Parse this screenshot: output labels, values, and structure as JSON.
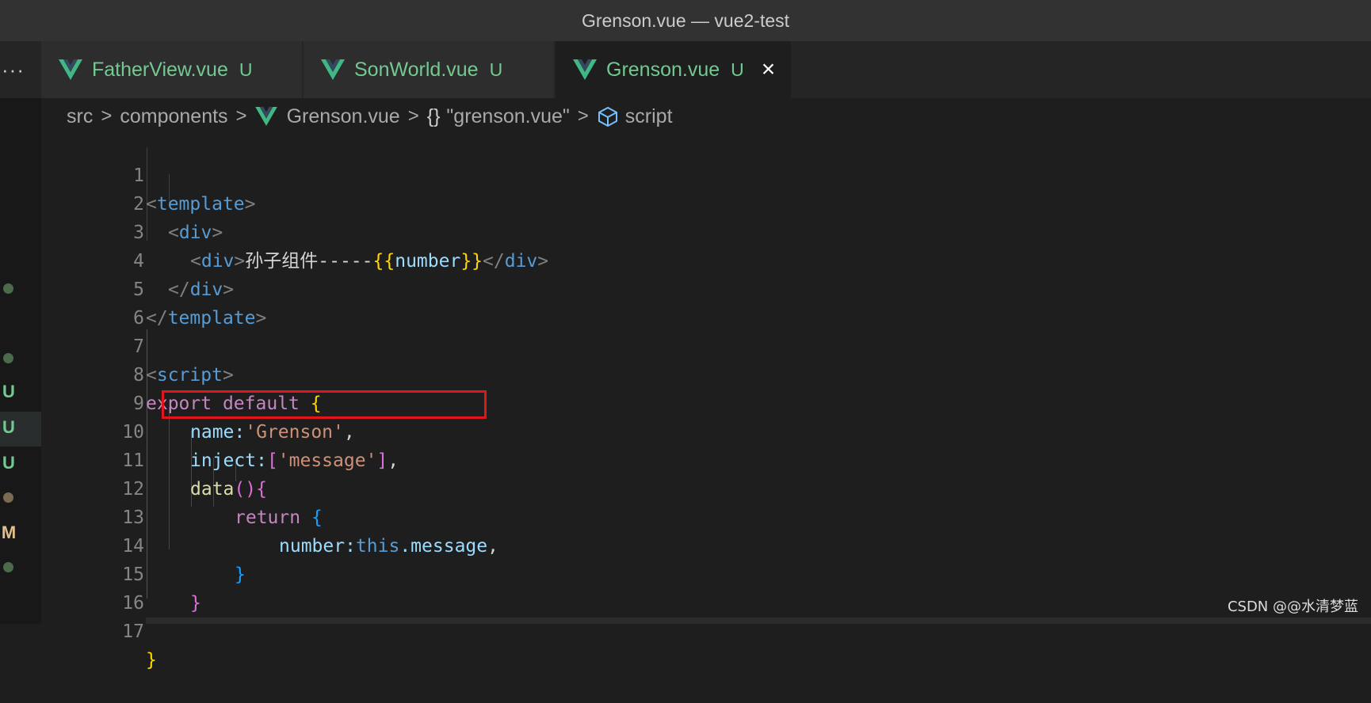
{
  "window": {
    "title": "Grenson.vue — vue2-test"
  },
  "tabs": [
    {
      "label": "FatherView.vue",
      "status": "U"
    },
    {
      "label": "SonWorld.vue",
      "status": "U"
    },
    {
      "label": "Grenson.vue",
      "status": "U",
      "active": true
    }
  ],
  "tabbar": {
    "overflow": "···",
    "close": "×"
  },
  "breadcrumb": {
    "items": [
      "src",
      "components",
      "Grenson.vue",
      "\"grenson.vue\"",
      "script"
    ],
    "separator": ">",
    "brace": "{}"
  },
  "gutter_marks": [
    "U",
    "U",
    "U",
    "M"
  ],
  "colors": {
    "vue": "#41b883",
    "modified": "#73c991",
    "highlight_box": "#e0161b"
  },
  "code": {
    "line_numbers": [
      "1",
      "2",
      "3",
      "4",
      "5",
      "6",
      "7",
      "8",
      "9",
      "10",
      "11",
      "12",
      "13",
      "14",
      "15",
      "16",
      "17"
    ],
    "l1": {
      "open": "<",
      "tag": "template",
      "close": ">"
    },
    "l2": {
      "open": "<",
      "tag": "div",
      "close": ">"
    },
    "l3": {
      "open": "<",
      "tag": "div",
      "close": ">",
      "text": "孙子组件-----",
      "mopen": "{{",
      "var": "number",
      "mclose": "}}",
      "endopen": "</",
      "endtag": "div",
      "endclose": ">"
    },
    "l4": {
      "open": "</",
      "tag": "div",
      "close": ">"
    },
    "l5": {
      "open": "</",
      "tag": "template",
      "close": ">"
    },
    "l7": {
      "open": "<",
      "tag": "script",
      "close": ">"
    },
    "l8": {
      "kw1": "export",
      "kw2": "default",
      "brace": "{"
    },
    "l9": {
      "prop": "name:",
      "str": "'Grenson'",
      "punc": ","
    },
    "l10": {
      "prop": "inject:",
      "bopen": "[",
      "str": "'message'",
      "bclose": "]",
      "punc": ","
    },
    "l11": {
      "fn": "data",
      "parens": "()",
      "brace": "{"
    },
    "l12": {
      "kw": "return",
      "brace": "{"
    },
    "l13": {
      "prop": "number:",
      "this": "this",
      "rest": ".message",
      "punc": ","
    },
    "l14": {
      "brace": "}"
    },
    "l15": {
      "brace": "}"
    },
    "l17": {
      "brace": "}"
    }
  },
  "watermark": "CSDN @@水清梦蓝"
}
